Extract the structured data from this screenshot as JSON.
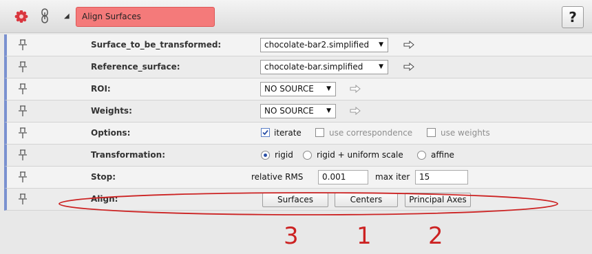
{
  "header": {
    "title": "Align Surfaces",
    "help_label": "?",
    "icons": [
      "gear-icon",
      "link-icon",
      "expand-triangle-icon"
    ]
  },
  "rows": {
    "surface_to_be_transformed": {
      "label": "Surface_to_be_transformed:",
      "value": "chocolate-bar2.simplified"
    },
    "reference_surface": {
      "label": "Reference_surface:",
      "value": "chocolate-bar.simplified"
    },
    "roi": {
      "label": "ROI:",
      "value": "NO SOURCE"
    },
    "weights": {
      "label": "Weights:",
      "value": "NO SOURCE"
    },
    "options": {
      "label": "Options:",
      "iterate": {
        "label": "iterate",
        "checked": true
      },
      "use_correspondence": {
        "label": "use correspondence",
        "checked": false
      },
      "use_weights": {
        "label": "use weights",
        "checked": false
      }
    },
    "transformation": {
      "label": "Transformation:",
      "options": [
        "rigid",
        "rigid + uniform scale",
        "affine"
      ],
      "selected": "rigid"
    },
    "stop": {
      "label": "Stop:",
      "relative_rms_label": "relative RMS",
      "relative_rms_value": "0.001",
      "max_iter_label": "max iter",
      "max_iter_value": "15"
    },
    "align": {
      "label": "Align:",
      "buttons": [
        "Surfaces",
        "Centers",
        "Principal Axes"
      ]
    }
  },
  "annotations": {
    "numbers": [
      "3",
      "1",
      "2"
    ],
    "color": "#cc2222"
  },
  "colors": {
    "title_highlight": "#f47a7a",
    "row_accent": "#7a91d0"
  }
}
